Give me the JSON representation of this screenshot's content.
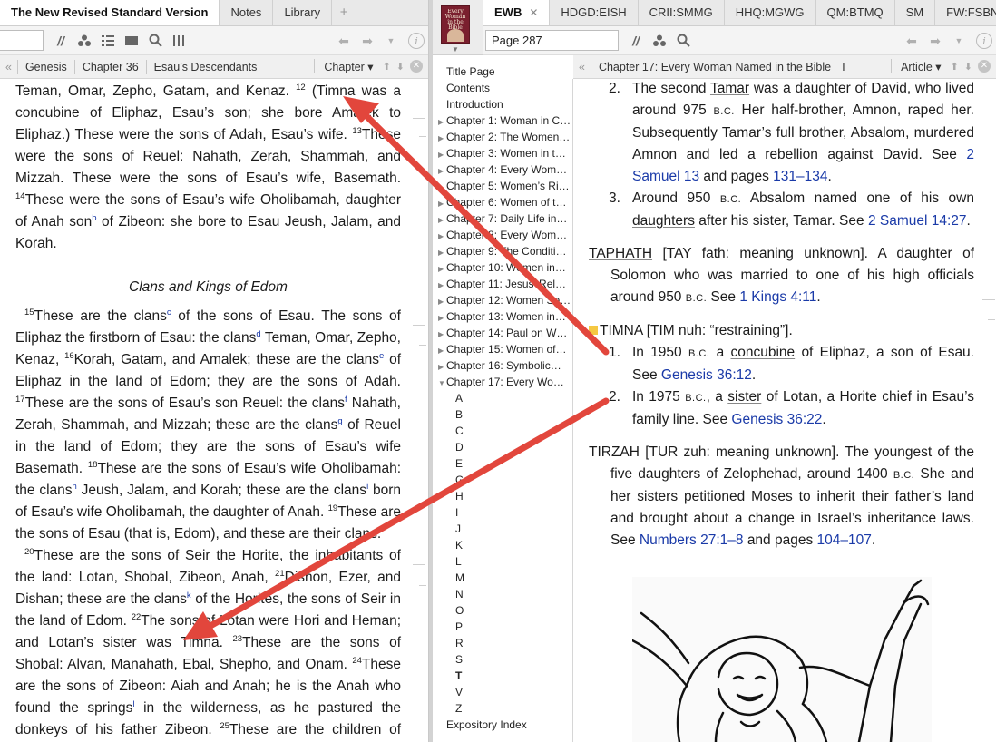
{
  "left": {
    "tabs": [
      {
        "label": "The New Revised Standard Version",
        "active": true
      },
      {
        "label": "Notes",
        "active": false
      },
      {
        "label": "Library",
        "active": false
      }
    ],
    "breadcrumb": [
      "Genesis",
      "Chapter 36",
      "Esau’s Descendants"
    ],
    "nav_menu": "Chapter ▾"
  },
  "right": {
    "tabs": [
      {
        "label": "EWB",
        "active": true
      },
      {
        "label": "HDGD:EISH",
        "active": false
      },
      {
        "label": "CRII:SMMG",
        "active": false
      },
      {
        "label": "HHQ:MGWG",
        "active": false
      },
      {
        "label": "QM:BTMQ",
        "active": false
      },
      {
        "label": "SM",
        "active": false
      },
      {
        "label": "FW:FSBN",
        "active": false
      }
    ],
    "ref_value": "Page 287",
    "breadcrumb": [
      "Chapter 17: Every Woman Named in the Bible",
      "T"
    ],
    "nav_menu": "Article ▾",
    "cover_text": "Every Woman in the Bible"
  },
  "toc": {
    "top": [
      "Title Page",
      "Contents",
      "Introduction"
    ],
    "chapters": [
      "Chapter 1: Woman in C…",
      "Chapter 2: The Women…",
      "Chapter 3: Women in t…",
      "Chapter 4: Every Wom…",
      "Chapter 5: Women’s Ri…",
      "Chapter 6: Women of t…",
      "Chapter 7: Daily Life in…",
      "Chapter 8: Every Wom…",
      "Chapter 9: The Conditi…",
      "Chapter 10: Women in…",
      "Chapter 11: Jesus’ Rel…",
      "Chapter 12: Women Sp…",
      "Chapter 13: Women in…",
      "Chapter 14: Paul on W…",
      "Chapter 15: Women of…",
      "Chapter 16: Symbolic…",
      "Chapter 17: Every Wo…"
    ],
    "letters": [
      "A",
      "B",
      "C",
      "D",
      "E",
      "G",
      "H",
      "I",
      "J",
      "K",
      "L",
      "M",
      "N",
      "O",
      "P",
      "R",
      "S",
      "T",
      "V",
      "Z"
    ],
    "bottom": "Expository Index"
  },
  "bible": {
    "p1": {
      "a": "Teman, Omar, Zepho, Gatam, and Kenaz.",
      "v12": "12",
      "b": "(Timna was a concubine of Eliphaz, Esau’s son; she bore Amalek to Eliphaz.) These were the sons of Adah, Esau’s wife.",
      "v13": "13",
      "c": "These were the sons of Reuel: Nahath, Zerah, Shammah, and Mizzah. These were the sons of Esau’s wife, Basemath.",
      "v14": "14",
      "d": "These were the sons of Esau’s wife Oholibamah, daughter of Anah son",
      "fn_b": "b",
      "e": "of Zibeon: she bore to Esau Jeush, Jalam, and Korah."
    },
    "heading": "Clans and Kings of Edom",
    "p2": {
      "v15": "15",
      "a": "These are the clans",
      "fn_c": "c",
      "b": "of the sons of Esau. The sons of Eliphaz the firstborn of Esau: the clans",
      "fn_d": "d",
      "c": "Teman, Omar, Zepho, Kenaz,",
      "v16": "16",
      "d": "Korah, Gatam, and Amalek; these are the clans",
      "fn_e": "e",
      "e": "of Eliphaz in the land of Edom; they are the sons of Adah.",
      "v17": "17",
      "f": "These are the sons of Esau’s son Reuel: the clans",
      "fn_f": "f",
      "g": "Nahath, Zerah, Shammah, and Mizzah; these are the clans",
      "fn_g": "g",
      "h": "of Reuel in the land of Edom; they are the sons of Esau’s wife Basemath.",
      "v18": "18",
      "i": "These are the sons of Esau’s wife Oholibamah: the clans",
      "fn_h": "h",
      "j": "Jeush, Jalam, and Korah; these are the clans",
      "fn_i": "i",
      "k": "born of Esau’s wife Oholibamah, the daughter of Anah.",
      "v19": "19",
      "l": "These are the sons of Esau (that is, Edom), and these are their clans."
    },
    "p3": {
      "v20": "20",
      "a": "These are the sons of Seir the Horite, the inhabitants of the land: Lotan, Shobal, Zibeon, Anah,",
      "v21": "21",
      "b": "Dishon, Ezer, and Dishan; these are the clans",
      "fn_k": "k",
      "c": "of the Horites, the sons of Seir in the land of Edom.",
      "v22": "22",
      "d": "The sons of Lotan were Hori and Heman; and Lotan’s sister was Timna.",
      "v23": "23",
      "e": "These are the sons of Shobal: Alvan, Manahath, Ebal, Shepho, and Onam.",
      "v24": "24",
      "f": "These are the sons of Zibeon: Aiah and Anah; he is the Anah who found the springs",
      "fn_l": "l",
      "g": "in the wilderness, as he pastured the donkeys of his father Zibeon.",
      "v25": "25",
      "h": "These are the children of Anah: Dishon and"
    }
  },
  "article": {
    "tamar2": {
      "num": "2.",
      "a": "The second",
      "name": "Tamar",
      "b": "was a daughter of David, who lived around 975",
      "bc": "B.C.",
      "c": "Her half-brother, Amnon, raped her. Subsequently Tamar’s full brother, Absalom, murdered Amnon and led a rebellion against David. See",
      "link1": "2 Samuel 13",
      "d": "and pages",
      "link2": "131–134",
      "e": "."
    },
    "tamar3": {
      "num": "3.",
      "a": "Around 950",
      "bc": "B.C.",
      "b": "Absalom named one of his own",
      "ul": "daughters",
      "c": "after his sister, Tamar. See",
      "link": "2 Samuel 14:27",
      "d": "."
    },
    "taphath": {
      "name": "TAPHATH",
      "a": "[TAY fath: meaning unknown]. A daughter of Solomon who was married to one of his high officials around 950",
      "bc": "B.C.",
      "b": "See",
      "link": "1 Kings 4:11",
      "c": "."
    },
    "timna": {
      "name": "TIMNA",
      "a": "[TIM nuh: “restraining”].",
      "i1": {
        "num": "1.",
        "a": "In 1950",
        "bc": "B.C.",
        "b": "a",
        "ul": "concubine",
        "c": "of Eliphaz, a son of Esau. See",
        "link": "Genesis 36:12",
        "d": "."
      },
      "i2": {
        "num": "2.",
        "a": "In 1975",
        "bc": "B.C.",
        "b": ", a",
        "ul": "sister",
        "c": "of Lotan, a Horite chief in Esau’s family line. See",
        "link": "Genesis 36:22",
        "d": "."
      }
    },
    "tirzah": {
      "name": "TIRZAH",
      "a": "[TUR zuh: meaning unknown]. The youngest of the five daughters of Zelophehad, around 1400",
      "bc": "B.C.",
      "b": "She and her sisters petitioned Moses to inherit their father’s land and brought about a change in Israel’s inheritance laws. See",
      "link1": "Numbers 27:1–8",
      "c": "and pages",
      "link2": "104–107",
      "d": "."
    }
  },
  "colors": {
    "arrow": "#e2463c",
    "link": "#1a3aa8",
    "note_flag": "#f5c842"
  }
}
